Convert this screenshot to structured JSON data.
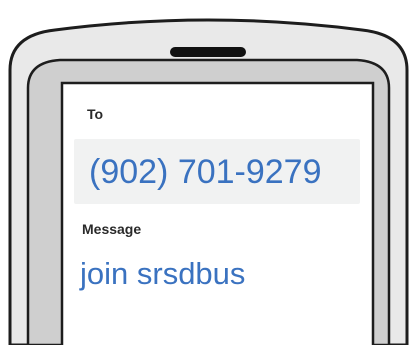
{
  "compose": {
    "to_label": "To",
    "to_value": "(902) 701-9279",
    "message_label": "Message",
    "message_value": "join srsdbus"
  },
  "colors": {
    "phone_body": "#e9e9e9",
    "phone_frame": "#cfcfcf",
    "outline": "#1d1d1d",
    "speaker": "#111111",
    "field_background": "#f1f2f2",
    "text_dark": "#2a2a2a",
    "text_accent": "#3a72c0"
  }
}
